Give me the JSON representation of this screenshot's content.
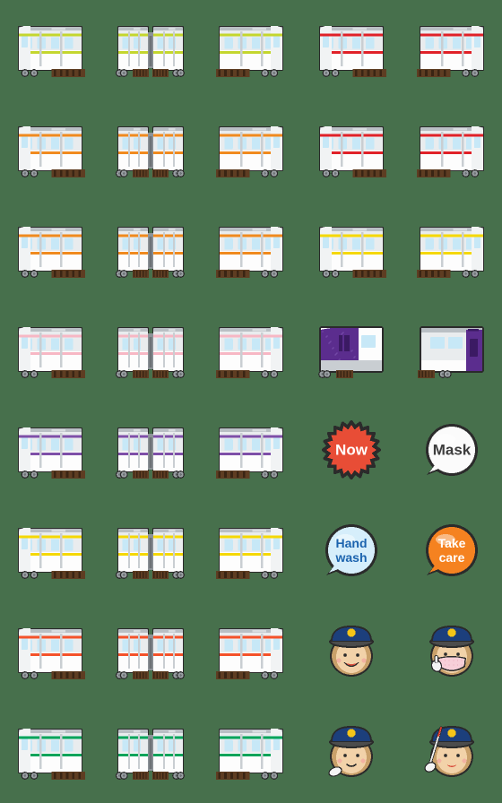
{
  "sheet": {
    "title": "Train Emoji Sticker Sheet",
    "background_color": "#47704c",
    "columns": 5,
    "rows": 8,
    "cell_size_px": 112
  },
  "palette": {
    "body_light": "#e9ecee",
    "body_white": "#fdfdfd",
    "body_gray": "#c9ced2",
    "roof_gray": "#b9bfc4",
    "outline": "#2b2b2b",
    "window_blue": "#c7e8f7",
    "track_brown": "#5e3d22",
    "wheel_gray": "#9a9fa3",
    "lime": "#c4d62e",
    "orange": "#f08a1e",
    "red": "#e02128",
    "yellow": "#f5d800",
    "pink": "#f7b7c4",
    "purple": "#5b2d8e",
    "violet": "#7e4fa8",
    "vermilion": "#f4522a",
    "green": "#00a45a",
    "skin": "#f2d2a9",
    "hair": "#c9a06a",
    "cap_navy": "#1c3f7c",
    "cap_button": "#f5c518",
    "mask_pink": "#f7cfd8",
    "glove_white": "#f4f4f4"
  },
  "items": [
    {
      "id": "r1c1",
      "row": 1,
      "col": 1,
      "kind": "train",
      "name": "lime-line-train-front-car",
      "label": "Lime line train front car",
      "accent": "#c4d62e",
      "variant": "front"
    },
    {
      "id": "r1c2",
      "row": 1,
      "col": 2,
      "kind": "train",
      "name": "lime-line-train-coupled-cars",
      "label": "Lime line train coupled cars",
      "accent": "#c4d62e",
      "variant": "coupled"
    },
    {
      "id": "r1c3",
      "row": 1,
      "col": 3,
      "kind": "train",
      "name": "lime-line-train-rear-car",
      "label": "Lime line train rear car",
      "accent": "#c4d62e",
      "variant": "rear"
    },
    {
      "id": "r1c4",
      "row": 1,
      "col": 4,
      "kind": "train",
      "name": "red-white-commuter-front-car",
      "label": "Red and white commuter front car",
      "accent": "#e02128",
      "variant": "front"
    },
    {
      "id": "r1c5",
      "row": 1,
      "col": 5,
      "kind": "train",
      "name": "red-white-commuter-rear-car",
      "label": "Red and white commuter rear car",
      "accent": "#e02128",
      "variant": "rear"
    },
    {
      "id": "r2c1",
      "row": 2,
      "col": 1,
      "kind": "train",
      "name": "orange-line-train-front-car",
      "label": "Orange line train front car",
      "accent": "#f08a1e",
      "variant": "front"
    },
    {
      "id": "r2c2",
      "row": 2,
      "col": 2,
      "kind": "train",
      "name": "orange-line-train-coupled-cars",
      "label": "Orange line train coupled cars",
      "accent": "#f08a1e",
      "variant": "coupled"
    },
    {
      "id": "r2c3",
      "row": 2,
      "col": 3,
      "kind": "train",
      "name": "orange-line-train-rear-car",
      "label": "Orange line train rear car",
      "accent": "#f08a1e",
      "variant": "rear"
    },
    {
      "id": "r2c4",
      "row": 2,
      "col": 4,
      "kind": "train",
      "name": "red-stripe-express-front-car",
      "label": "Red stripe express front car",
      "accent": "#e02128",
      "variant": "front"
    },
    {
      "id": "r2c5",
      "row": 2,
      "col": 5,
      "kind": "train",
      "name": "red-stripe-express-rear-car",
      "label": "Red stripe express rear car",
      "accent": "#e02128",
      "variant": "rear"
    },
    {
      "id": "r3c1",
      "row": 3,
      "col": 1,
      "kind": "train",
      "name": "orange-band-train-front-car",
      "label": "Orange band train front car",
      "accent": "#f08a1e",
      "variant": "front"
    },
    {
      "id": "r3c2",
      "row": 3,
      "col": 2,
      "kind": "train",
      "name": "orange-band-train-coupled-cars",
      "label": "Orange band train coupled cars",
      "accent": "#f08a1e",
      "variant": "coupled"
    },
    {
      "id": "r3c3",
      "row": 3,
      "col": 3,
      "kind": "train",
      "name": "orange-band-train-rear-car",
      "label": "Orange band train rear car",
      "accent": "#f08a1e",
      "variant": "rear"
    },
    {
      "id": "r3c4",
      "row": 3,
      "col": 4,
      "kind": "train",
      "name": "yellow-line-train-front-car",
      "label": "Yellow line train front car",
      "accent": "#f5d800",
      "variant": "front"
    },
    {
      "id": "r3c5",
      "row": 3,
      "col": 5,
      "kind": "train",
      "name": "yellow-line-train-rear-car",
      "label": "Yellow line train rear car",
      "accent": "#f5d800",
      "variant": "rear"
    },
    {
      "id": "r4c1",
      "row": 4,
      "col": 1,
      "kind": "train",
      "name": "pink-line-train-front-car",
      "label": "Pink line train front car",
      "accent": "#f7b7c4",
      "variant": "front"
    },
    {
      "id": "r4c2",
      "row": 4,
      "col": 2,
      "kind": "train",
      "name": "pink-line-train-coupled-cars",
      "label": "Pink line train coupled cars",
      "accent": "#f7b7c4",
      "variant": "coupled"
    },
    {
      "id": "r4c3",
      "row": 4,
      "col": 3,
      "kind": "train",
      "name": "pink-line-train-rear-car",
      "label": "Pink line train rear car",
      "accent": "#f7b7c4",
      "variant": "rear"
    },
    {
      "id": "r4c4",
      "row": 4,
      "col": 4,
      "kind": "train",
      "name": "purple-sleeper-locomotive",
      "label": "Purple sleeper locomotive",
      "accent": "#5b2d8e",
      "variant": "loco"
    },
    {
      "id": "r4c5",
      "row": 4,
      "col": 5,
      "kind": "train",
      "name": "purple-sleeper-passenger-car",
      "label": "Purple sleeper passenger car",
      "accent": "#5b2d8e",
      "variant": "coach"
    },
    {
      "id": "r5c1",
      "row": 5,
      "col": 1,
      "kind": "train",
      "name": "violet-line-train-front-car",
      "label": "Violet line train front car",
      "accent": "#7e4fa8",
      "variant": "front"
    },
    {
      "id": "r5c2",
      "row": 5,
      "col": 2,
      "kind": "train",
      "name": "violet-line-train-coupled-cars",
      "label": "Violet line train coupled cars",
      "accent": "#7e4fa8",
      "variant": "coupled"
    },
    {
      "id": "r5c3",
      "row": 5,
      "col": 3,
      "kind": "train",
      "name": "violet-line-train-rear-car",
      "label": "Violet line train rear car",
      "accent": "#7e4fa8",
      "variant": "rear"
    },
    {
      "id": "r5c4",
      "row": 5,
      "col": 4,
      "kind": "badge",
      "name": "now-starburst-badge",
      "label": "Now",
      "text": "Now",
      "shape": "starburst",
      "fill": "#e84d36",
      "text_color": "#ffffff",
      "lines": [
        "Now"
      ]
    },
    {
      "id": "r5c5",
      "row": 5,
      "col": 5,
      "kind": "badge",
      "name": "mask-speech-bubble-badge",
      "label": "Mask",
      "text": "Mask",
      "shape": "bubble",
      "fill": "#fbfbfb",
      "text_color": "#3d3d3d",
      "lines": [
        "Mask"
      ]
    },
    {
      "id": "r6c1",
      "row": 6,
      "col": 1,
      "kind": "train",
      "name": "yellow-band-train-front-car",
      "label": "Yellow band train front car",
      "accent": "#f5d800",
      "variant": "front"
    },
    {
      "id": "r6c2",
      "row": 6,
      "col": 2,
      "kind": "train",
      "name": "yellow-band-train-coupled-cars",
      "label": "Yellow band train coupled cars",
      "accent": "#f5d800",
      "variant": "coupled"
    },
    {
      "id": "r6c3",
      "row": 6,
      "col": 3,
      "kind": "train",
      "name": "yellow-band-train-rear-car",
      "label": "Yellow band train rear car",
      "accent": "#f5d800",
      "variant": "rear"
    },
    {
      "id": "r6c4",
      "row": 6,
      "col": 4,
      "kind": "badge",
      "name": "hand-wash-speech-bubble-badge",
      "label": "Hand wash",
      "text": "Hand wash",
      "shape": "bubble",
      "fill": "#d6eefb",
      "text_color": "#1b63ae",
      "lines": [
        "Hand",
        "wash"
      ]
    },
    {
      "id": "r6c5",
      "row": 6,
      "col": 5,
      "kind": "badge",
      "name": "take-care-speech-bubble-badge",
      "label": "Take care",
      "text": "Take care",
      "shape": "bubble",
      "fill": "#f58220",
      "text_color": "#ffffff",
      "lines": [
        "Take",
        "care"
      ]
    },
    {
      "id": "r7c1",
      "row": 7,
      "col": 1,
      "kind": "train",
      "name": "vermilion-line-train-front-car",
      "label": "Vermilion line train front car",
      "accent": "#f4522a",
      "variant": "front"
    },
    {
      "id": "r7c2",
      "row": 7,
      "col": 2,
      "kind": "train",
      "name": "vermilion-line-train-coupled-cars",
      "label": "Vermilion line train coupled cars",
      "accent": "#f4522a",
      "variant": "coupled"
    },
    {
      "id": "r7c3",
      "row": 7,
      "col": 3,
      "kind": "train",
      "name": "vermilion-line-train-rear-car",
      "label": "Vermilion line train rear car",
      "accent": "#f4522a",
      "variant": "rear"
    },
    {
      "id": "r7c4",
      "row": 7,
      "col": 4,
      "kind": "face",
      "name": "woman-conductor-smiling-face",
      "label": "Woman conductor smiling",
      "face_variant": "smile"
    },
    {
      "id": "r7c5",
      "row": 7,
      "col": 5,
      "kind": "face",
      "name": "woman-conductor-wearing-mask-face",
      "label": "Woman conductor wearing mask",
      "face_variant": "mask"
    },
    {
      "id": "r8c1",
      "row": 8,
      "col": 1,
      "kind": "train",
      "name": "green-line-train-front-car",
      "label": "Green line train front car",
      "accent": "#00a45a",
      "variant": "front"
    },
    {
      "id": "r8c2",
      "row": 8,
      "col": 2,
      "kind": "train",
      "name": "green-line-train-coupled-cars",
      "label": "Green line train coupled cars",
      "accent": "#00a45a",
      "variant": "coupled"
    },
    {
      "id": "r8c3",
      "row": 8,
      "col": 3,
      "kind": "train",
      "name": "green-line-train-rear-car",
      "label": "Green line train rear car",
      "accent": "#00a45a",
      "variant": "rear"
    },
    {
      "id": "r8c4",
      "row": 8,
      "col": 4,
      "kind": "face",
      "name": "woman-conductor-gloved-hand-face",
      "label": "Woman conductor with gloved hand",
      "face_variant": "glove"
    },
    {
      "id": "r8c5",
      "row": 8,
      "col": 5,
      "kind": "face",
      "name": "woman-conductor-pointing-baton-face",
      "label": "Woman conductor pointing with baton",
      "face_variant": "baton"
    }
  ]
}
